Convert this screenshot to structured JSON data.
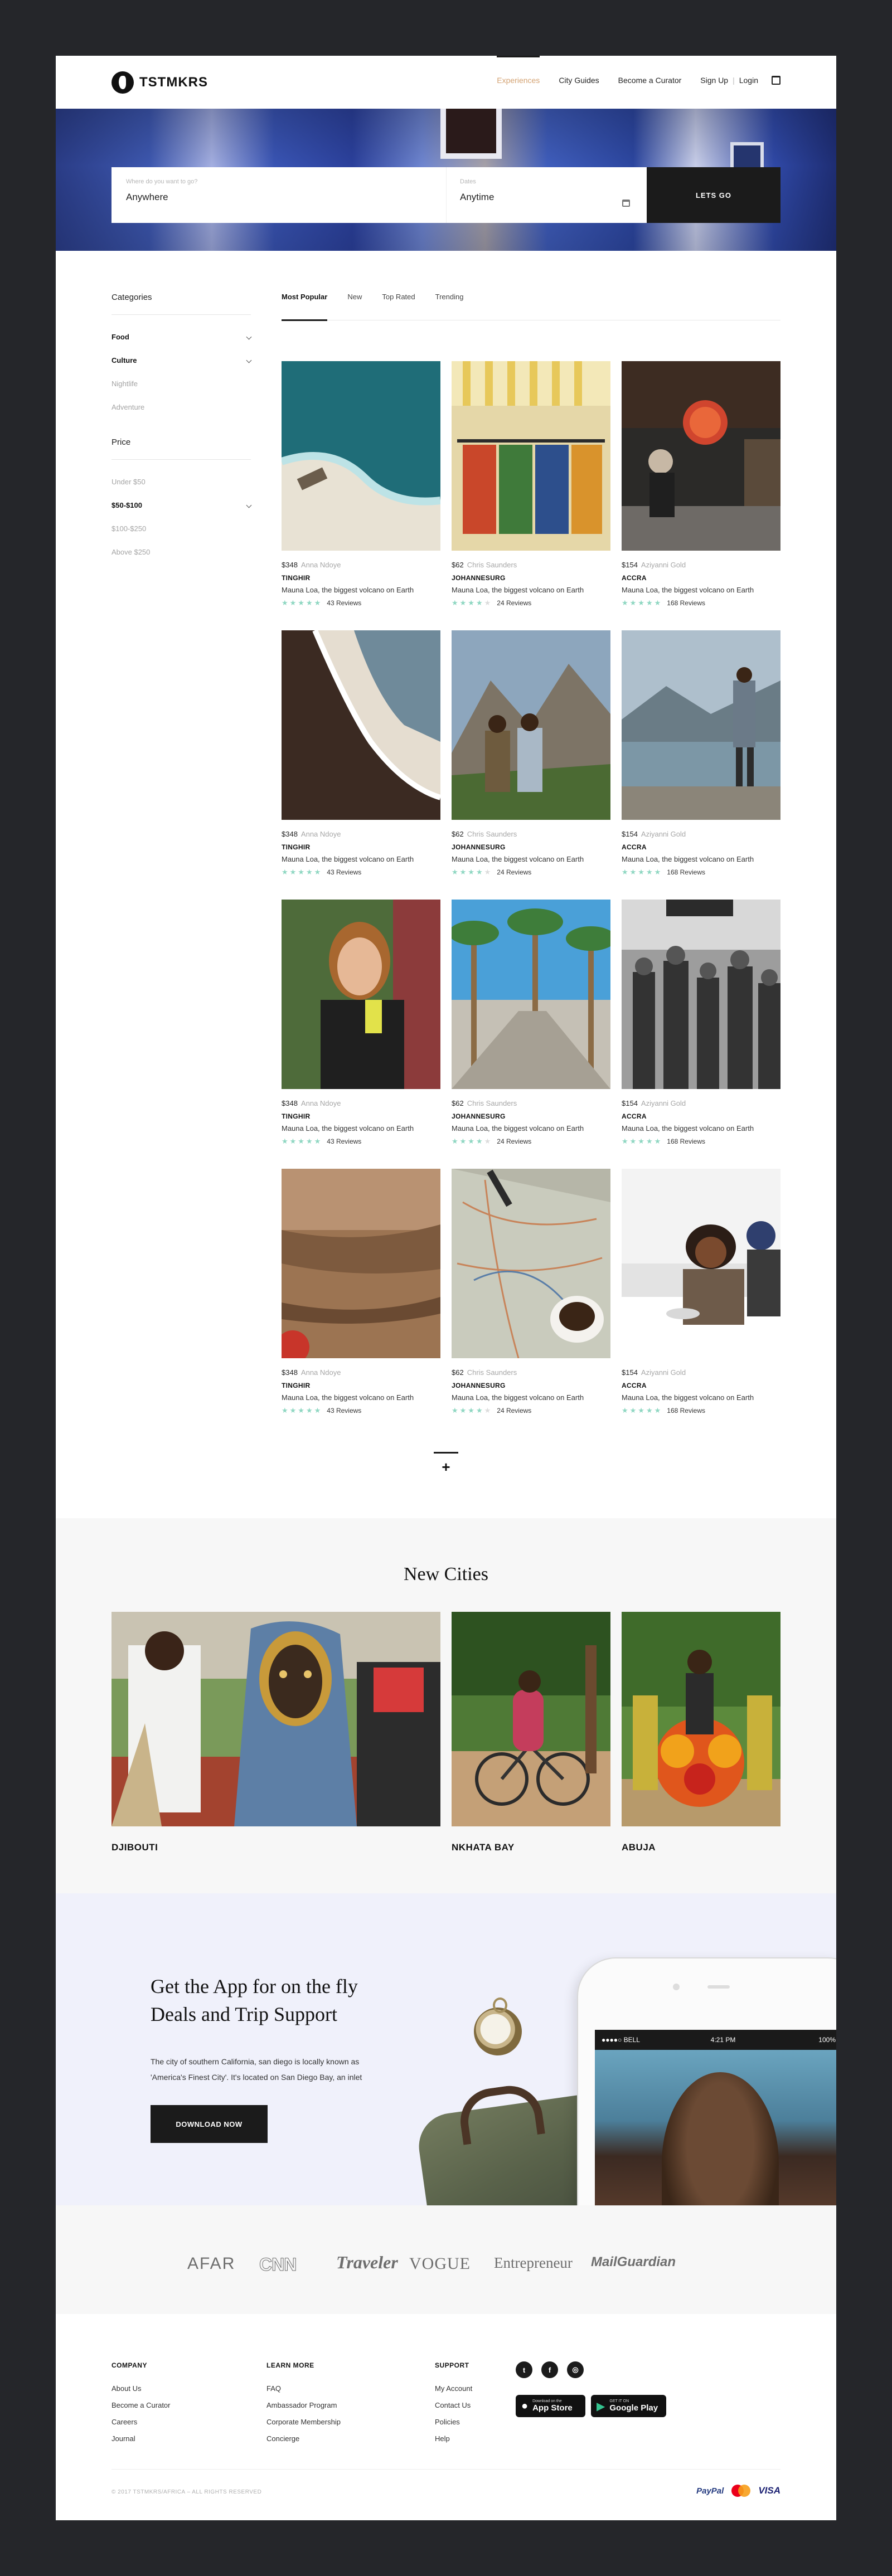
{
  "header": {
    "brand": "TSTMKRS",
    "nav": [
      "Experiences",
      "City Guides",
      "Become a Curator"
    ],
    "signup": "Sign Up",
    "login": "Login",
    "sep": "|"
  },
  "search": {
    "where_label": "Where do you want to go?",
    "where_placeholder": "Anywhere",
    "when_label": "Dates",
    "when_placeholder": "Anytime",
    "go_label": "LETS GO"
  },
  "sidebar": {
    "categories_title": "Categories",
    "categories": [
      {
        "label": "Food",
        "bold": true,
        "chevron": true
      },
      {
        "label": "Culture",
        "bold": true,
        "chevron": true
      },
      {
        "label": "Nightlife",
        "bold": false,
        "chevron": false
      },
      {
        "label": "Adventure",
        "bold": false,
        "chevron": false
      }
    ],
    "price_title": "Price",
    "prices": [
      {
        "label": "Under $50",
        "bold": false,
        "chevron": false
      },
      {
        "label": "$50-$100",
        "bold": true,
        "chevron": true
      },
      {
        "label": "$100-$250",
        "bold": false,
        "chevron": false
      },
      {
        "label": "Above $250",
        "bold": false,
        "chevron": false
      }
    ]
  },
  "tabs": [
    "Most Popular",
    "New",
    "Top Rated",
    "Trending"
  ],
  "listings": [
    {
      "price": "$348",
      "author": "Anna Ndoye",
      "city": "TINGHIR",
      "desc": "Mauna Loa, the biggest volcano on Earth",
      "rating": 5,
      "reviews": "43 Reviews",
      "photo": "aerial-beach"
    },
    {
      "price": "$62",
      "author": "Chris Saunders",
      "city": "JOHANNESURG",
      "desc": "Mauna Loa, the biggest volcano on Earth",
      "rating": 4,
      "reviews": "24 Reviews",
      "photo": "fabric-stall"
    },
    {
      "price": "$154",
      "author": "Aziyanni Gold",
      "city": "ACCRA",
      "desc": "Mauna Loa, the biggest volcano on Earth",
      "rating": 5,
      "reviews": "168 Reviews",
      "photo": "lantern-street"
    },
    {
      "price": "$348",
      "author": "Anna Ndoye",
      "city": "TINGHIR",
      "desc": "Mauna Loa, the biggest volcano on Earth",
      "rating": 5,
      "reviews": "43 Reviews",
      "photo": "coastline"
    },
    {
      "price": "$62",
      "author": "Chris Saunders",
      "city": "JOHANNESURG",
      "desc": "Mauna Loa, the biggest volcano on Earth",
      "rating": 4,
      "reviews": "24 Reviews",
      "photo": "mountain-hikers"
    },
    {
      "price": "$154",
      "author": "Aziyanni Gold",
      "city": "ACCRA",
      "desc": "Mauna Loa, the biggest volcano on Earth",
      "rating": 5,
      "reviews": "168 Reviews",
      "photo": "lake-traveler"
    },
    {
      "price": "$348",
      "author": "Anna Ndoye",
      "city": "TINGHIR",
      "desc": "Mauna Loa, the biggest volcano on Earth",
      "rating": 5,
      "reviews": "43 Reviews",
      "photo": "woman-drink"
    },
    {
      "price": "$62",
      "author": "Chris Saunders",
      "city": "JOHANNESURG",
      "desc": "Mauna Loa, the biggest volcano on Earth",
      "rating": 4,
      "reviews": "24 Reviews",
      "photo": "palm-promenade"
    },
    {
      "price": "$154",
      "author": "Aziyanni Gold",
      "city": "ACCRA",
      "desc": "Mauna Loa, the biggest volcano on Earth",
      "rating": 5,
      "reviews": "168 Reviews",
      "photo": "street-crowd"
    },
    {
      "price": "$348",
      "author": "Anna Ndoye",
      "city": "TINGHIR",
      "desc": "Mauna Loa, the biggest volcano on Earth",
      "rating": 5,
      "reviews": "43 Reviews",
      "photo": "desert-rock"
    },
    {
      "price": "$62",
      "author": "Chris Saunders",
      "city": "JOHANNESURG",
      "desc": "Mauna Loa, the biggest volcano on Earth",
      "rating": 4,
      "reviews": "24 Reviews",
      "photo": "map-coffee"
    },
    {
      "price": "$154",
      "author": "Aziyanni Gold",
      "city": "ACCRA",
      "desc": "Mauna Loa, the biggest volcano on Earth",
      "rating": 5,
      "reviews": "168 Reviews",
      "photo": "dinner-table"
    }
  ],
  "load_more": "+",
  "cities": {
    "title": "New Cities",
    "items": [
      {
        "name": "DJIBOUTI",
        "photo": "masked-dancer"
      },
      {
        "name": "NKHATA BAY",
        "photo": "cyclist"
      },
      {
        "name": "ABUJA",
        "photo": "festival-costume"
      }
    ]
  },
  "app": {
    "title_line1": "Get the App for on the fly",
    "title_line2": "Deals and Trip Support",
    "text_line1": "The city of southern California, san diego is locally known as",
    "text_line2": "'America's Finest City'. It's located on San Diego Bay, an inlet",
    "button": "DOWNLOAD NOW",
    "phone_carrier": "●●●●○ BELL",
    "phone_time": "4:21 PM",
    "phone_battery": "100%"
  },
  "press": [
    "AFAR",
    "CNN",
    "Traveler",
    "VOGUE",
    "Entrepreneur",
    "MailGuardian"
  ],
  "footer": {
    "company_title": "COMPANY",
    "company": [
      "About Us",
      "Become a Curator",
      "Careers",
      "Journal"
    ],
    "learn_title": "LEARN MORE",
    "learn": [
      "FAQ",
      "Ambassador Program",
      "Corporate Membership",
      "Concierge"
    ],
    "support_title": "SUPPORT",
    "support": [
      "My Account",
      "Contact Us",
      "Policies",
      "Help"
    ],
    "social": [
      "twitter-icon",
      "facebook-icon",
      "instagram-icon"
    ],
    "app_store_small": "Download on the",
    "app_store": "App Store",
    "google_small": "GET IT ON",
    "google": "Google Play",
    "copyright": "© 2017 TSTMKRS/AFRICA – ALL RIGHTS RESERVED",
    "payments": [
      "PayPal",
      "VISA"
    ]
  },
  "colors": {
    "accent": "#d4a373",
    "star": "#8fd7c2",
    "dark": "#1b1b1b",
    "frame": "#25262a"
  }
}
